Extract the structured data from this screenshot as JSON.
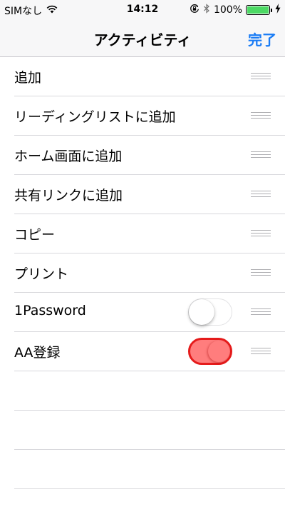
{
  "status_bar": {
    "carrier": "SIMなし",
    "time": "14:12",
    "battery_percent": "100%",
    "battery_level": 1.0,
    "icons": [
      "wifi-icon",
      "orientation-lock-icon",
      "bluetooth-icon",
      "battery-icon",
      "charging-bolt-icon"
    ]
  },
  "nav": {
    "title": "アクティビティ",
    "done_label": "完了"
  },
  "list": {
    "items": [
      {
        "label": "追加"
      },
      {
        "label": "リーディングリストに追加"
      },
      {
        "label": "ホーム画面に追加"
      },
      {
        "label": "共有リンクに追加"
      },
      {
        "label": "コピー"
      },
      {
        "label": "プリント"
      },
      {
        "label": "1Password",
        "toggle": "off"
      },
      {
        "label": "AA登録",
        "toggle": "on"
      }
    ]
  },
  "colors": {
    "accent": "#1a7cf5",
    "battery_green": "#4cd964",
    "toggle_on_fill": "#ff7d7d",
    "toggle_on_border": "#e51b1b",
    "separator": "#d8d8dc",
    "bar_background": "#f7f7f8"
  }
}
